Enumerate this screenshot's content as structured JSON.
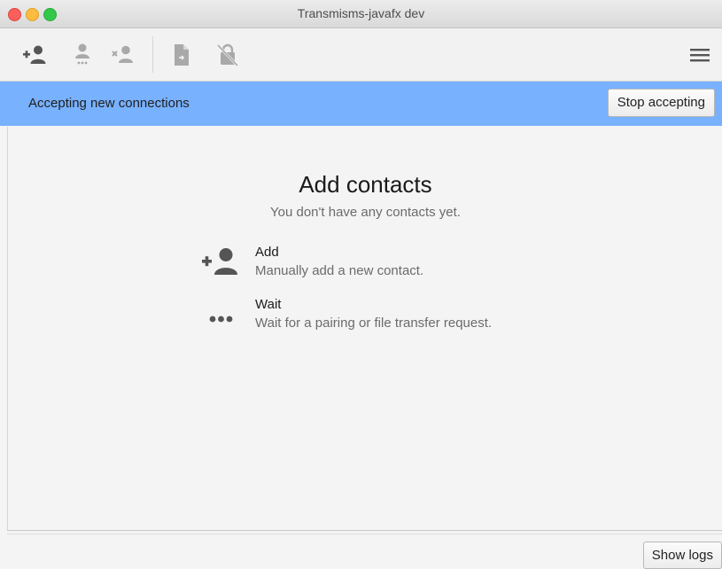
{
  "window": {
    "title": "Transmisms-javafx dev"
  },
  "toolbar": {
    "icons": [
      "add-contact-icon",
      "wait-contact-icon",
      "remove-contact-icon",
      "send-file-icon",
      "lock-disabled-icon",
      "menu-icon"
    ]
  },
  "banner": {
    "text": "Accepting new connections",
    "button_label": "Stop accepting",
    "color": "#78b1fd"
  },
  "main": {
    "heading": "Add contacts",
    "subheading": "You don't have any contacts yet.",
    "options": [
      {
        "icon": "add-contact-icon",
        "title": "Add",
        "description": "Manually add a new contact."
      },
      {
        "icon": "ellipsis-icon",
        "title": "Wait",
        "description": "Wait for a pairing or file transfer request."
      }
    ]
  },
  "status": {
    "logs_button_label": "Show logs"
  }
}
